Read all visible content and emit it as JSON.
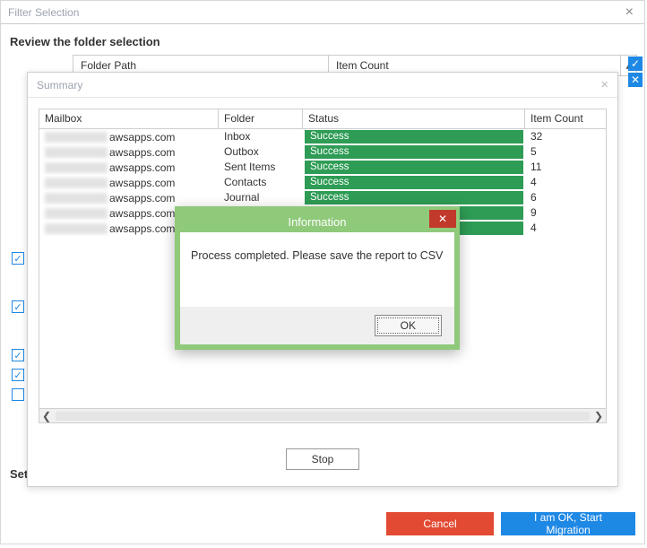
{
  "filter_selection": {
    "title": "Filter Selection",
    "subtitle": "Review the folder selection",
    "grid": {
      "col_folder_path": "Folder Path",
      "col_item_count": "Item Count"
    },
    "set_label_truncated": "Set",
    "footer": {
      "cancel": "Cancel",
      "start": "I am OK, Start Migration"
    },
    "left_checks": [
      {
        "checked": true
      },
      {
        "checked": true
      },
      {
        "checked": true
      },
      {
        "checked": true
      },
      {
        "checked": false
      }
    ]
  },
  "summary": {
    "title": "Summary",
    "columns": {
      "mailbox": "Mailbox",
      "folder": "Folder",
      "status": "Status",
      "item_count": "Item Count"
    },
    "mailbox_suffix": "awsapps.com",
    "rows": [
      {
        "folder": "Inbox",
        "status": "Success",
        "count": "32"
      },
      {
        "folder": "Outbox",
        "status": "Success",
        "count": "5"
      },
      {
        "folder": "Sent Items",
        "status": "Success",
        "count": "11"
      },
      {
        "folder": "Contacts",
        "status": "Success",
        "count": "4"
      },
      {
        "folder": "Journal",
        "status": "Success",
        "count": "6"
      },
      {
        "folder": "",
        "status": "Success",
        "count": "9"
      },
      {
        "folder": "",
        "status": "Success",
        "count": "4"
      }
    ],
    "stop": "Stop"
  },
  "info": {
    "title": "Information",
    "message": "Process completed. Please save the report to CSV",
    "ok": "OK"
  }
}
